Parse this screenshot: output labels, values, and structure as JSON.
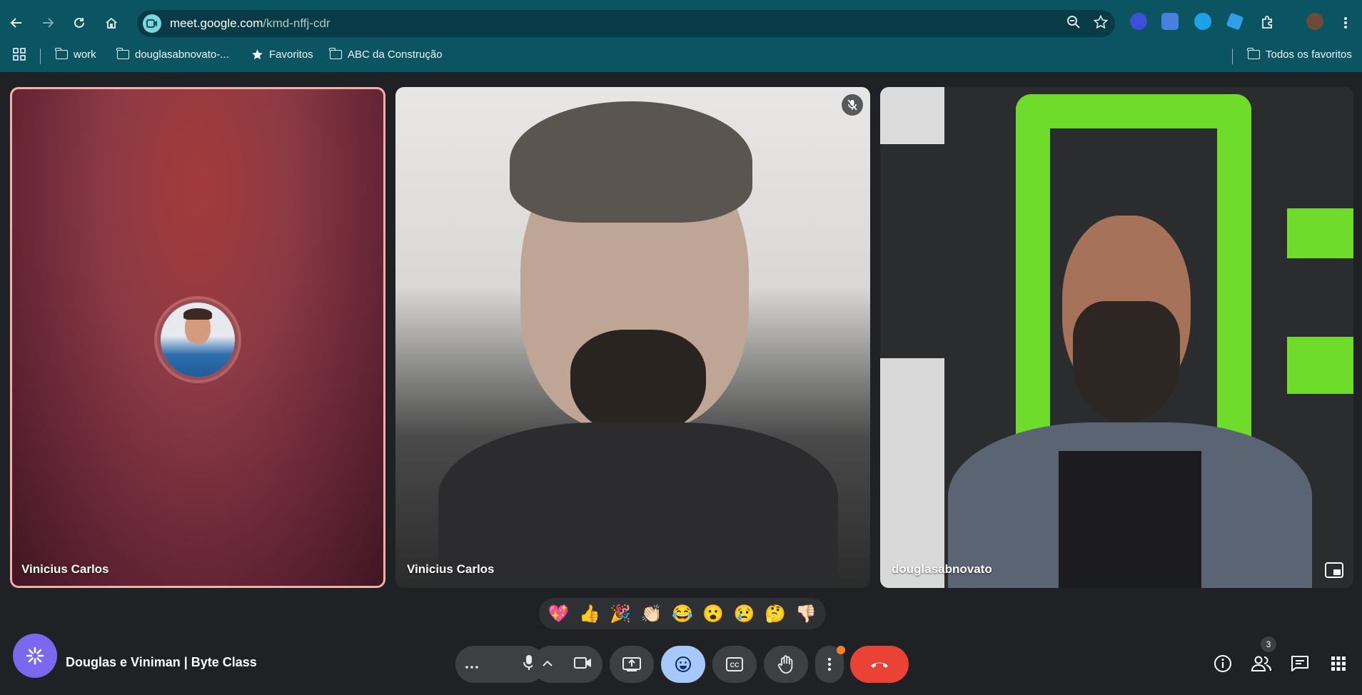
{
  "browser": {
    "url_host": "meet.google.com",
    "url_path": "/kmd-nffj-cdr",
    "bookmarks": [
      {
        "label": "work",
        "type": "folder"
      },
      {
        "label": "douglasabnovato-...",
        "type": "folder"
      },
      {
        "label": "Favoritos",
        "type": "star"
      },
      {
        "label": "ABC da Construção",
        "type": "folder"
      }
    ],
    "all_bookmarks_label": "Todos os favoritos"
  },
  "tiles": [
    {
      "name": "Vinicius Carlos",
      "kind": "avatar",
      "active_speaker": true
    },
    {
      "name": "Vinicius Carlos",
      "kind": "video",
      "muted": true
    },
    {
      "name": "douglasabnovato",
      "kind": "video"
    }
  ],
  "reactions": [
    "💖",
    "👍",
    "🎉",
    "👏🏻",
    "😂",
    "😮",
    "😢",
    "🤔",
    "👎🏻"
  ],
  "meeting": {
    "title": "Douglas e Viniman | Byte Class",
    "participants_count": "3"
  },
  "colors": {
    "browser_chrome": "#0b5563",
    "meet_background": "#202124",
    "leave_button": "#ea4335",
    "active_control": "#a8c7fa",
    "active_speaker_border": "#f6aea9"
  }
}
